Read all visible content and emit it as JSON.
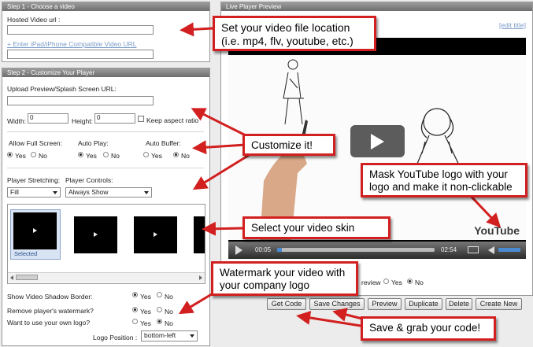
{
  "step1": {
    "header": "Step 1 - Choose a video",
    "hosted_label": "Hosted Video url :",
    "hosted_value": "",
    "ipad_link": "+ Enter iPad/iPhone Compatible Video URL",
    "ipad_value": ""
  },
  "step2": {
    "header": "Step 2 - Customize Your Player",
    "splash_label": "Upload Preview/Splash Screen URL:",
    "splash_value": "",
    "width_label": "Width:",
    "width_value": "0",
    "height_label": "Height:",
    "height_value": "0",
    "aspect_label": "Keep aspect ratio",
    "fullscreen_label": "Allow Full Screen:",
    "autoplay_label": "Auto Play:",
    "autobuffer_label": "Auto Buffer:",
    "yes": "Yes",
    "no": "No",
    "stretching_label": "Player Stretching:",
    "stretching_value": "Fill",
    "controls_label": "Player Controls:",
    "controls_value": "Always Show",
    "skin_selected": "Selected",
    "shadow_label": "Show Video Shadow Border:",
    "watermark_label": "Remove player's watermark?",
    "own_logo_label": "Want to use your own logo?",
    "logo_position_label": "Logo Position :",
    "logo_position_value": "bottom-left"
  },
  "preview": {
    "header": "Live Player Preview",
    "edit_title": "[edit title]",
    "time_current": "00:05",
    "time_total": "02:54",
    "youtube_logo": "YouTube",
    "shadow_partial": "review",
    "yes": "Yes",
    "no": "No"
  },
  "buttons": {
    "get_code": "Get Code",
    "save_changes": "Save Changes",
    "preview": "Preview",
    "duplicate": "Duplicate",
    "delete": "Delete",
    "create_new": "Create New"
  },
  "callouts": {
    "location": "Set your video file location (i.e. mp4, flv, youtube, etc.)",
    "customize": "Customize it!",
    "mask": "Mask YouTube logo with your logo and make it non-clickable",
    "skin": "Select your video skin",
    "watermark": "Watermark your video with your company logo",
    "save": "Save & grab your code!"
  },
  "colors": {
    "callout_border": "#d21f1f",
    "arrow": "#d21f1f",
    "panel_header": "#808080",
    "link": "#7a9cc8"
  }
}
